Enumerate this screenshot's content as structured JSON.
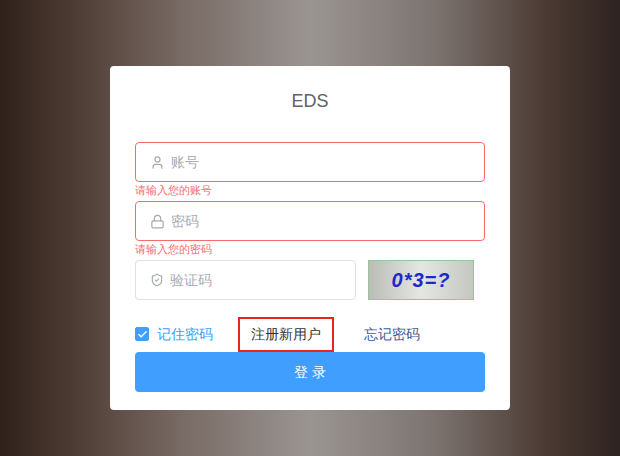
{
  "login_card": {
    "title": "EDS",
    "fields": [
      {
        "placeholder": "账号",
        "error": "请输入您的账号",
        "kind": "account",
        "invalid": true
      },
      {
        "placeholder": "密码",
        "error": "请输入您的密码",
        "kind": "password",
        "invalid": true
      }
    ],
    "captcha": {
      "placeholder": "验证码",
      "image_text": "0*3=?"
    },
    "remember": {
      "label": "记住密码",
      "checked": true
    },
    "links": [
      {
        "label": "注册新用户",
        "highlighted": true
      },
      {
        "label": "忘记密码",
        "highlighted": false
      }
    ],
    "submit": "登 录"
  }
}
